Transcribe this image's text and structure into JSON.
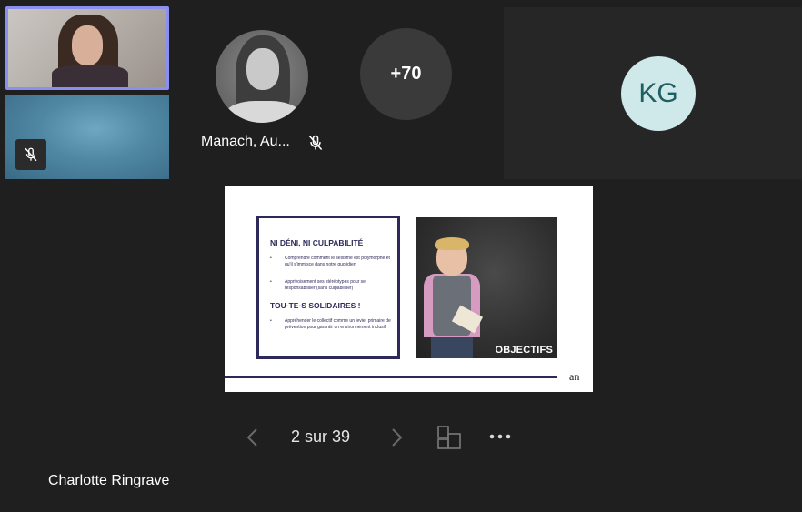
{
  "participants": {
    "overflow_count": "+70",
    "featured_name": "Manach, Au...",
    "initials_avatar": "KG",
    "presenter": "Charlotte Ringrave"
  },
  "slide": {
    "heading1": "NI DÉNI, NI CULPABILITÉ",
    "bullets1": [
      "Comprendre comment le sexisme est polymorphe et qu'il s'immisce dans notre quotidien",
      "Apprivoisement ses stéréotypes pour se responsabiliser (sans culpabiliser)"
    ],
    "heading2": "TOU·TE·S SOLIDAIRES !",
    "bullets2": [
      "Appréhender le collectif comme un levier primaire de prévention pour garantir un environnement inclusif"
    ],
    "photo_caption": "OBJECTIFS",
    "logo": "an",
    "bullet_mark": "•"
  },
  "navigation": {
    "page_counter": "2 sur 39"
  },
  "colors": {
    "background": "#1f1f1f",
    "active_speaker_border": "#8b8ff0",
    "kg_avatar_bg": "#cfe9ea",
    "kg_avatar_text": "#1e5f63",
    "slide_accent": "#2d2a5a"
  },
  "icons": {
    "mic_off": "mic-off-icon",
    "prev": "chevron-left-icon",
    "next": "chevron-right-icon",
    "layout": "layout-icon",
    "more": "more-horizontal-icon"
  }
}
